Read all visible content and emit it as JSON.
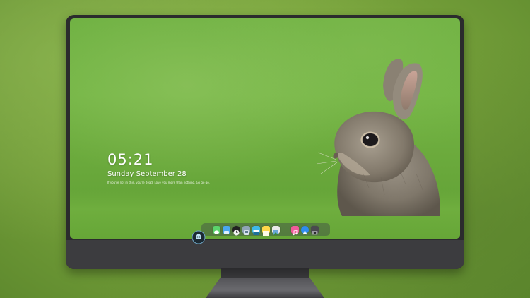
{
  "lock_screen": {
    "time": "05:21",
    "date": "Sunday September  28",
    "note": "If you're not in this, you're dead. Love you more than nothing. Go go go."
  },
  "dock": {
    "icons": [
      {
        "name": "messages-icon",
        "color": "#5bd36b"
      },
      {
        "name": "finder-icon",
        "color": "#4aa7f0"
      },
      {
        "name": "clock-icon",
        "color": "#f2f2f2"
      },
      {
        "name": "system-settings-icon",
        "color": "#8fa4b5"
      },
      {
        "name": "video-icon",
        "color": "#3fb8e8"
      },
      {
        "name": "notes-icon",
        "color": "#ffd84a"
      },
      {
        "name": "photos-icon",
        "color": "#e9e9e9"
      },
      {
        "name": "music-icon",
        "color": "#f15a9a"
      },
      {
        "name": "app-store-icon",
        "color": "#2e8cf0"
      },
      {
        "name": "camera-icon",
        "color": "#4a4a4f"
      }
    ]
  },
  "colors": {
    "bezel": "#2b2b2d",
    "chin": "#3c3c3f",
    "wallpaper_green": "#6fb142"
  }
}
